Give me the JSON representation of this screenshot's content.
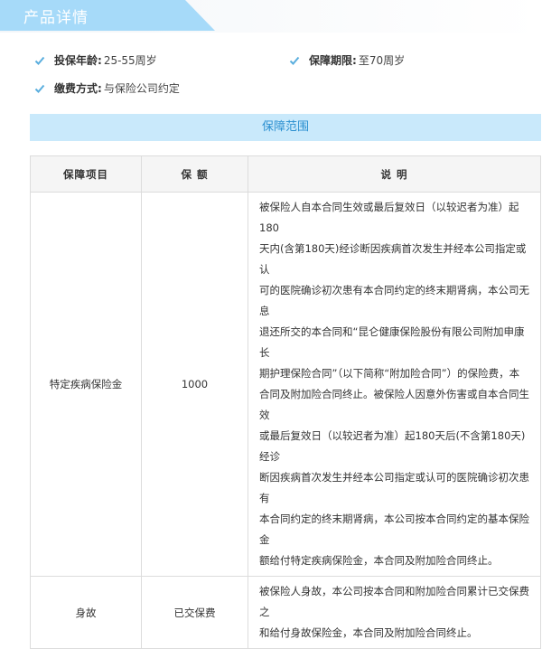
{
  "header": {
    "title": "产品详情"
  },
  "info": {
    "age": {
      "label": "投保年龄:",
      "value": "25-55周岁"
    },
    "period": {
      "label": "保障期限:",
      "value": "至70周岁"
    },
    "payment": {
      "label": "缴费方式:",
      "value": "与保险公司约定"
    }
  },
  "coverage": {
    "title": "保障范围",
    "columns": [
      "保障项目",
      "保 额",
      "说 明"
    ],
    "rows": [
      {
        "item": "特定疾病保险金",
        "amount": "1000",
        "desc_lines": [
          "被保险人自本合同生效或最后复效日（以较迟者为准）起180",
          "天内(含第180天)经诊断因疾病首次发生并经本公司指定或认",
          "可的医院确诊初次患有本合同约定的终末期肾病，本公司无息",
          "退还所交的本合同和“昆仑健康保险股份有限公司附加申康长",
          "期护理保险合同”（以下简称“附加险合同”）的保险费，本",
          "合同及附加险合同终止。被保险人因意外伤害或自本合同生效",
          "或最后复效日（以较迟者为准）起180天后(不含第180天)经诊",
          "断因疾病首次发生并经本公司指定或认可的医院确诊初次患有",
          "本合同约定的终末期肾病，本公司按本合同约定的基本保险金",
          "额给付特定疾病保险金，本合同及附加险合同终止。"
        ]
      },
      {
        "item": "身故",
        "amount": "已交保费",
        "desc_lines": [
          "被保险人身故，本公司按本合同和附加险合同累计已交保费之",
          "和给付身故保险金，本合同及附加险合同终止。"
        ]
      }
    ]
  },
  "colors": {
    "accent": "#a6daf9",
    "bar": "#c9e9fb",
    "bar_text": "#2a8fd0",
    "check": "#5aaede"
  },
  "icons": {
    "check": "check-icon"
  }
}
